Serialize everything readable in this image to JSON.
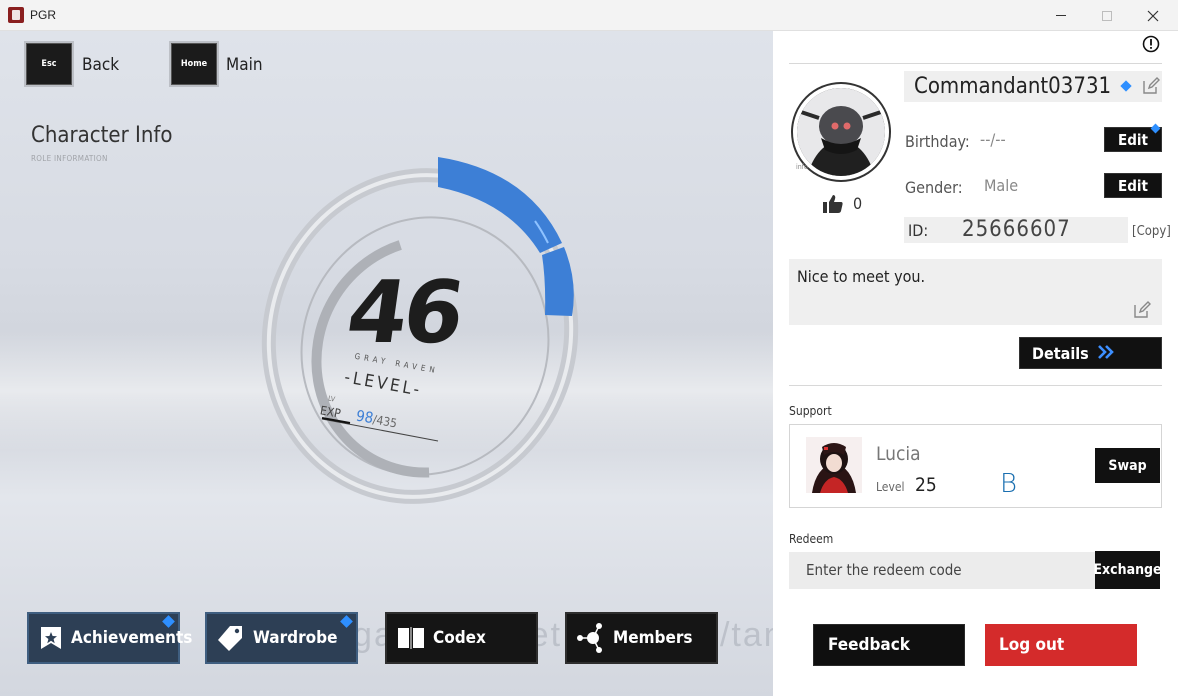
{
  "window": {
    "title": "PGR",
    "controls": [
      "minimize",
      "maximize",
      "close"
    ]
  },
  "nav": {
    "back_key": "Esc",
    "back_label": "Back",
    "main_key": "Home",
    "main_label": "Main"
  },
  "character_info": {
    "title": "Character Info",
    "subtitle": "ROLE INFORMATION",
    "level": "46",
    "team": "GRAY RAVEN",
    "level_word": "-LEVEL-",
    "lv_small": "LV",
    "exp_label": "EXP",
    "exp_current": "98",
    "exp_max": "/435",
    "exp_progress": 0.2253
  },
  "bottom_buttons": {
    "achievements": "Achievements",
    "wardrobe": "Wardrobe",
    "codex": "Codex",
    "members": "Members"
  },
  "watermark": "https://gamemarket.gg/seller/tang john",
  "profile": {
    "name": "Commandant03731",
    "birthday_label": "Birthday:",
    "birthday_value": "--/--",
    "gender_label": "Gender:",
    "gender_value": "Male",
    "edit_label": "Edit",
    "likes": "0",
    "id_label": "ID:",
    "id_value": "25666607",
    "copy_label": "[Copy]",
    "motto": "Nice to meet you.",
    "details_label": "Details",
    "avatar_caption": "info"
  },
  "support": {
    "section_label": "Support",
    "name": "Lucia",
    "level_label": "Level",
    "level": "25",
    "rank_mark": "B",
    "swap_label": "Swap"
  },
  "redeem": {
    "section_label": "Redeem",
    "placeholder": "Enter the redeem code",
    "exchange_label": "Exchange"
  },
  "footer": {
    "feedback_label": "Feedback",
    "logout_label": "Log out"
  },
  "colors": {
    "accent_blue": "#3d7fd6",
    "logout_red": "#d42b2b",
    "button_dark": "#111111",
    "bottom_blue": "#2d3f55"
  }
}
